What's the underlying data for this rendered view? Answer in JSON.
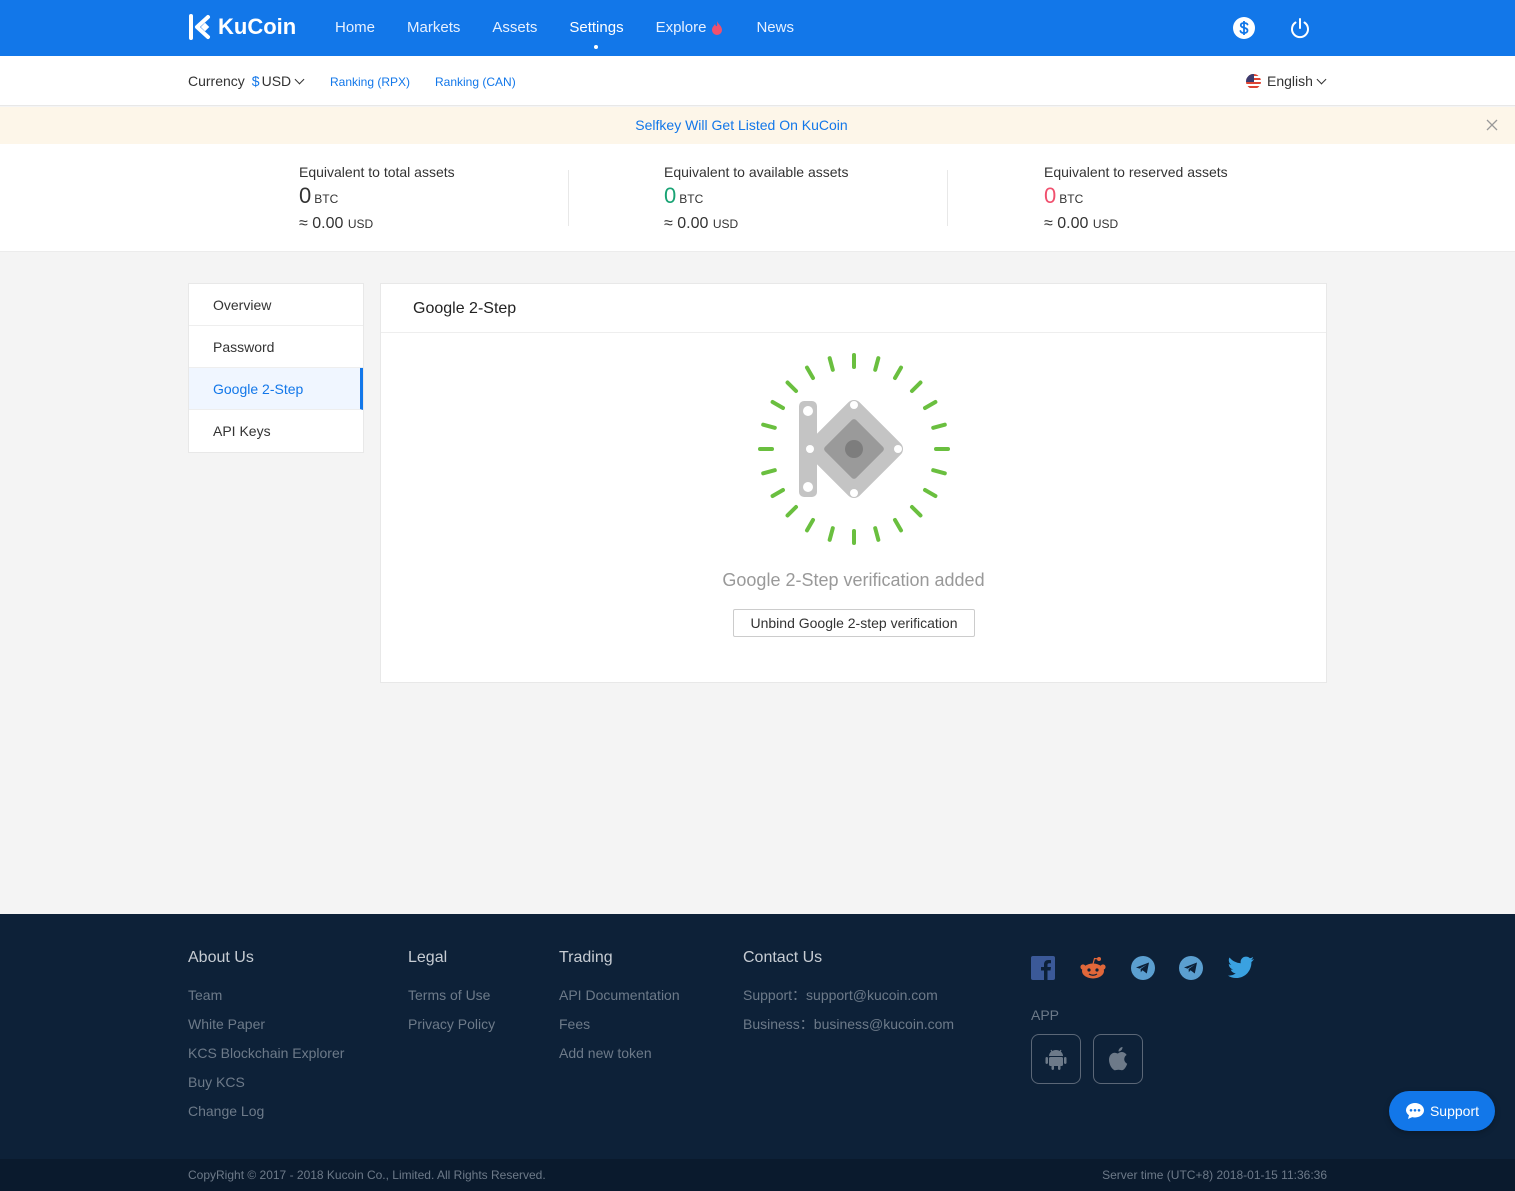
{
  "header": {
    "logo_text": "KuCoin",
    "nav": [
      "Home",
      "Markets",
      "Assets",
      "Settings",
      "Explore",
      "News"
    ],
    "active_nav": "Settings"
  },
  "subbar": {
    "currency_label": "Currency",
    "currency_symbol": "$",
    "currency_value": "USD",
    "ranking_rpx": "Ranking (RPX)",
    "ranking_can": "Ranking (CAN)",
    "language": "English"
  },
  "notice": {
    "text": "Selfkey Will Get Listed On KuCoin"
  },
  "assets": {
    "total": {
      "label": "Equivalent to total assets",
      "btc": "0",
      "btc_unit": "BTC",
      "usd": "≈ 0.00",
      "usd_unit": "USD"
    },
    "available": {
      "label": "Equivalent to available assets",
      "btc": "0",
      "btc_unit": "BTC",
      "usd": "≈ 0.00",
      "usd_unit": "USD"
    },
    "reserved": {
      "label": "Equivalent to reserved assets",
      "btc": "0",
      "btc_unit": "BTC",
      "usd": "≈ 0.00",
      "usd_unit": "USD"
    }
  },
  "sidebar": {
    "items": [
      "Overview",
      "Password",
      "Google 2-Step",
      "API Keys"
    ],
    "active": "Google 2-Step"
  },
  "main": {
    "title": "Google 2-Step",
    "status": "Google 2-Step verification added",
    "unbind_label": "Unbind Google 2-step verification"
  },
  "footer": {
    "about": {
      "title": "About Us",
      "links": [
        "Team",
        "White Paper",
        "KCS Blockchain Explorer",
        "Buy KCS",
        "Change Log"
      ]
    },
    "legal": {
      "title": "Legal",
      "links": [
        "Terms of Use",
        "Privacy Policy"
      ]
    },
    "trading": {
      "title": "Trading",
      "links": [
        "API Documentation",
        "Fees",
        "Add new token"
      ]
    },
    "contact": {
      "title": "Contact Us",
      "support": "Support：support@kucoin.com",
      "business": "Business：business@kucoin.com"
    },
    "app_label": "APP",
    "copyright": "CopyRight © 2017 - 2018 Kucoin Co., Limited. All Rights Reserved.",
    "server_time": "Server time (UTC+8) 2018-01-15 11:36:36"
  },
  "support_button": "Support",
  "colors": {
    "brand": "#1277e9",
    "positive": "#19a374",
    "negative": "#f0506e",
    "footer_bg": "#0d2138",
    "check_green": "#6abf3f"
  },
  "icons": [
    "kucoin-logo-icon",
    "fire-icon",
    "dollar-icon",
    "power-icon",
    "chevron-down-icon",
    "us-flag-icon",
    "close-icon",
    "google-2step-illustration",
    "facebook-icon",
    "reddit-icon",
    "telegram-icon",
    "twitter-icon",
    "android-icon",
    "apple-icon",
    "chat-icon"
  ]
}
